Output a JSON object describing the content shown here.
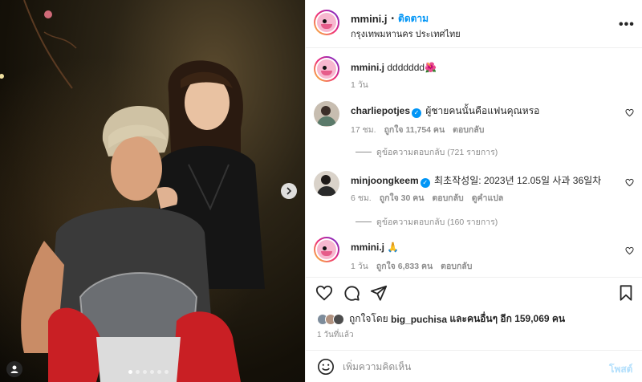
{
  "post": {
    "username": "mmini.j",
    "separator": "•",
    "follow_label": "ติดตาม",
    "location": "กรุงเทพมหานคร ประเทศไทย",
    "more_label": "•••"
  },
  "comments": [
    {
      "username": "mmini.j",
      "text": "ddddddd🌺",
      "time": "1 วัน",
      "likes": "",
      "reply_label": "",
      "extra": "",
      "replies": ""
    },
    {
      "username": "charliepotjes",
      "verified": true,
      "text": "ผู้ชายคนนั้นคือแฟนคุณหรอ",
      "time": "17 ชม.",
      "likes": "ถูกใจ 11,754 คน",
      "reply_label": "ตอบกลับ",
      "extra": "",
      "replies": "ดูข้อความตอบกลับ (721 รายการ)"
    },
    {
      "username": "minjoongkeem",
      "verified": true,
      "text": "최초작성일: 2023년 12.05일 사과 36일차",
      "time": "6 ชม.",
      "likes": "ถูกใจ 30 คน",
      "reply_label": "ตอบกลับ",
      "extra": "ดูคำแปล",
      "replies": "ดูข้อความตอบกลับ (160 รายการ)"
    },
    {
      "username": "mmini.j",
      "text": "🙏",
      "time": "1 วัน",
      "likes": "ถูกใจ 6,833 คน",
      "reply_label": "ตอบกลับ",
      "extra": "",
      "replies": ""
    }
  ],
  "likes_summary": {
    "prefix": "ถูกใจโดย",
    "user": "big_puchisa",
    "middle": "และคนอื่นๆ อีก",
    "count": "159,069 คน"
  },
  "posted_ago": "1 วันที่แล้ว",
  "compose": {
    "placeholder": "เพิ่มความคิดเห็น",
    "post_label": "โพสต์"
  },
  "icons": {
    "like": "heart-icon",
    "comment": "comment-bubble-icon",
    "share": "paper-plane-icon",
    "save": "bookmark-icon",
    "emoji": "smiley-icon",
    "next": "chevron-right-icon",
    "tag": "user-tag-icon"
  },
  "colors": {
    "accent": "#0095f6",
    "muted": "#8e8e8e",
    "post_disabled": "#b2dffc"
  }
}
